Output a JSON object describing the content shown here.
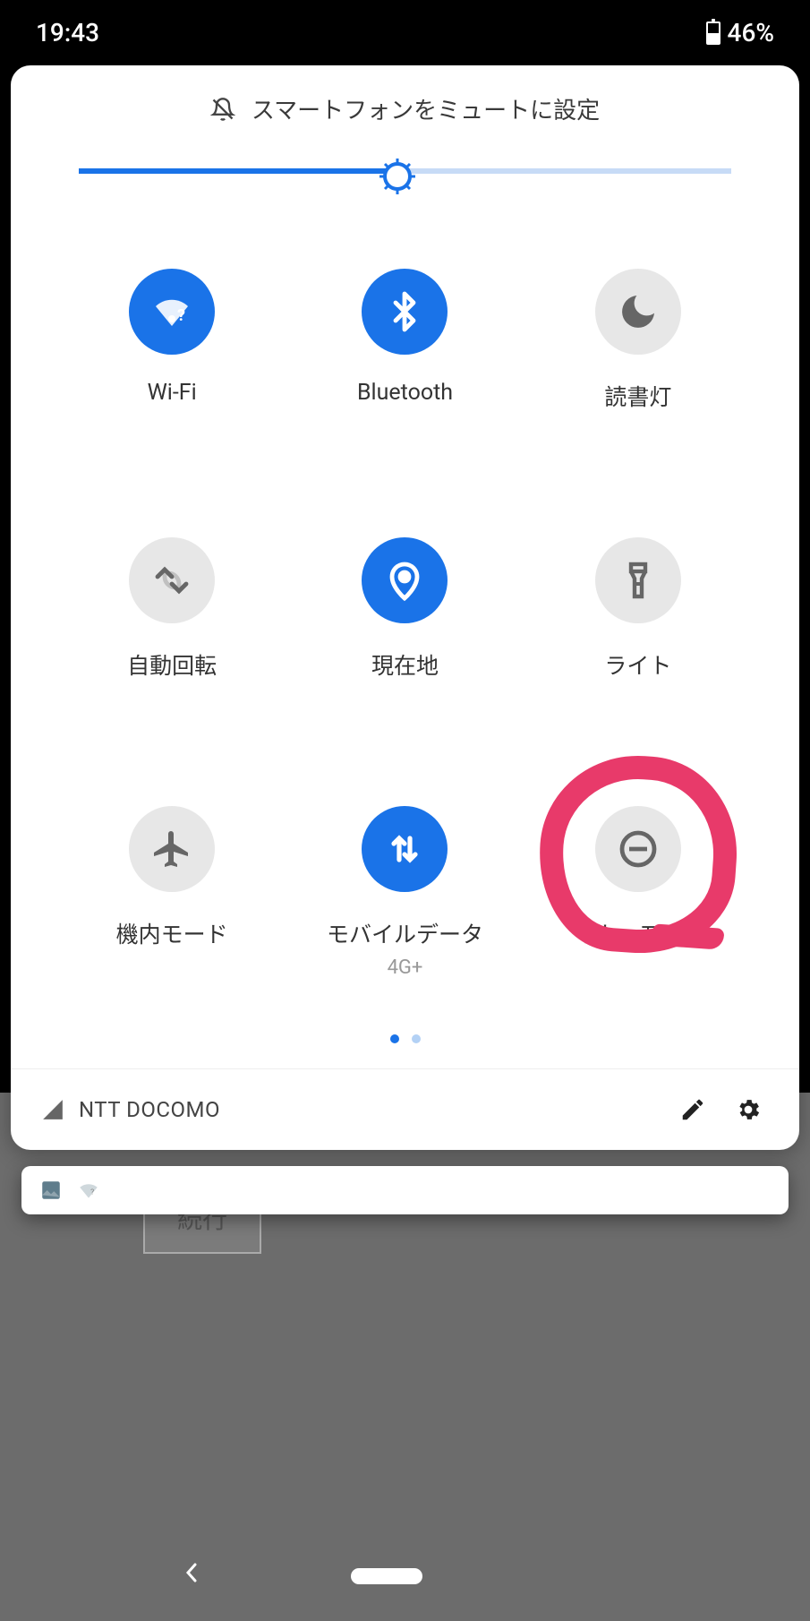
{
  "status": {
    "time": "19:43",
    "battery_pct": "46%"
  },
  "header": {
    "title": "スマートフォンをミュートに設定"
  },
  "brightness": {
    "value_pct": 49
  },
  "tiles": [
    {
      "id": "wifi",
      "label": "Wi-Fi",
      "sublabel": "",
      "active": true,
      "icon": "wifi-question"
    },
    {
      "id": "bluetooth",
      "label": "Bluetooth",
      "sublabel": "",
      "active": true,
      "icon": "bluetooth"
    },
    {
      "id": "readinglight",
      "label": "読書灯",
      "sublabel": "",
      "active": false,
      "icon": "moon"
    },
    {
      "id": "autorotate",
      "label": "自動回転",
      "sublabel": "",
      "active": false,
      "icon": "rotate"
    },
    {
      "id": "location",
      "label": "現在地",
      "sublabel": "",
      "active": true,
      "icon": "location-pin"
    },
    {
      "id": "flashlight",
      "label": "ライト",
      "sublabel": "",
      "active": false,
      "icon": "flashlight"
    },
    {
      "id": "airplane",
      "label": "機内モード",
      "sublabel": "",
      "active": false,
      "icon": "airplane"
    },
    {
      "id": "mobiledata",
      "label": "モバイルデータ",
      "sublabel": "4G+",
      "active": true,
      "icon": "data-arrows"
    },
    {
      "id": "dnd",
      "label": "マナーモード",
      "sublabel": "",
      "active": false,
      "icon": "do-not-disturb",
      "annotated": true
    }
  ],
  "pager": {
    "count": 2,
    "active_index": 0
  },
  "footer": {
    "carrier": "NTT DOCOMO"
  },
  "background": {
    "button_label": "続行"
  },
  "colors": {
    "accent": "#1a73e8",
    "tile_off_bg": "#e7e7e7",
    "annotation": "#e83a6a"
  }
}
